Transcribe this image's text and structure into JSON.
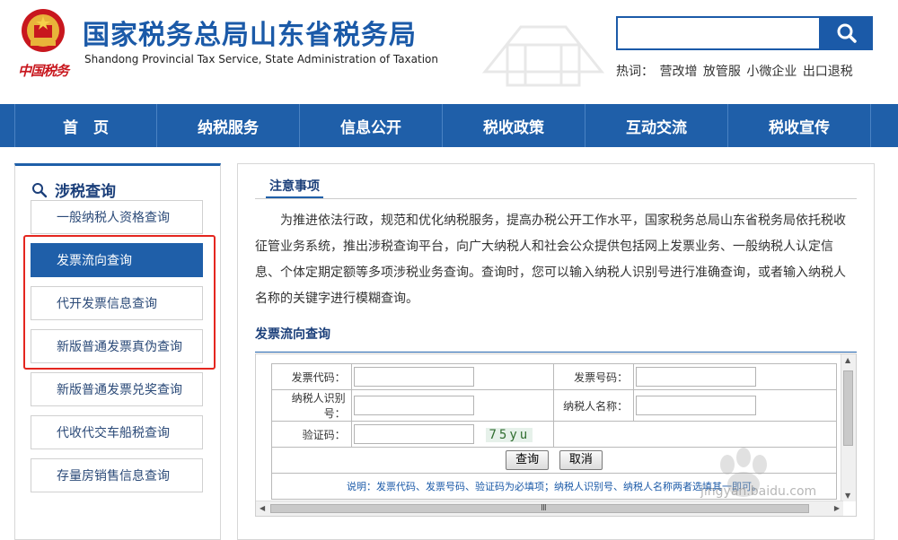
{
  "header": {
    "title_cn": "国家税务总局山东省税务局",
    "title_en": "Shandong Provincial Tax Service, State Administration of Taxation",
    "brand_script": "中国税务",
    "search": {
      "value": "",
      "placeholder": ""
    },
    "hotwords_label": "热词：",
    "hotwords": [
      "营改增",
      "放管服",
      "小微企业",
      "出口退税"
    ]
  },
  "nav": {
    "items": [
      "首　页",
      "纳税服务",
      "信息公开",
      "税收政策",
      "互动交流",
      "税收宣传"
    ]
  },
  "sidebar": {
    "title": "涉税查询",
    "items": [
      {
        "label": "一般纳税人资格查询",
        "active": false
      },
      {
        "label": "发票流向查询",
        "active": true
      },
      {
        "label": "代开发票信息查询",
        "active": false
      },
      {
        "label": "新版普通发票真伪查询",
        "active": false
      },
      {
        "label": "新版普通发票兑奖查询",
        "active": false
      },
      {
        "label": "代收代交车船税查询",
        "active": false
      },
      {
        "label": "存量房销售信息查询",
        "active": false
      }
    ]
  },
  "notice": {
    "tab": "注意事项",
    "text": "为推进依法行政，规范和优化纳税服务，提高办税公开工作水平，国家税务总局山东省税务局依托税收征管业务系统，推出涉税查询平台，向广大纳税人和社会公众提供包括网上发票业务、一般纳税人认定信息、个体定期定额等多项涉税业务查询。查询时，您可以输入纳税人识别号进行准确查询，或者输入纳税人名称的关键字进行模糊查询。"
  },
  "query": {
    "title": "发票流向查询",
    "invoice_code_label": "发票代码：",
    "invoice_number_label": "发票号码：",
    "taxpayer_id_label": "纳税人识别号：",
    "taxpayer_name_label": "纳税人名称：",
    "captcha_label": "验证码：",
    "captcha_text": "75yu",
    "invoice_code_value": "",
    "invoice_number_value": "",
    "taxpayer_id_value": "",
    "taxpayer_name_value": "",
    "captcha_value": "",
    "query_button": "查询",
    "cancel_button": "取消",
    "note": "说明：发票代码、发票号码、验证码为必填项；纳税人识别号、纳税人名称两者选填其一即可。"
  },
  "watermark": {
    "baidu_text": "jingyan.baidu.com"
  },
  "colors": {
    "primary_blue": "#1f5fa9",
    "title_blue": "#1b5aa8",
    "highlight_red": "#e4261f"
  }
}
